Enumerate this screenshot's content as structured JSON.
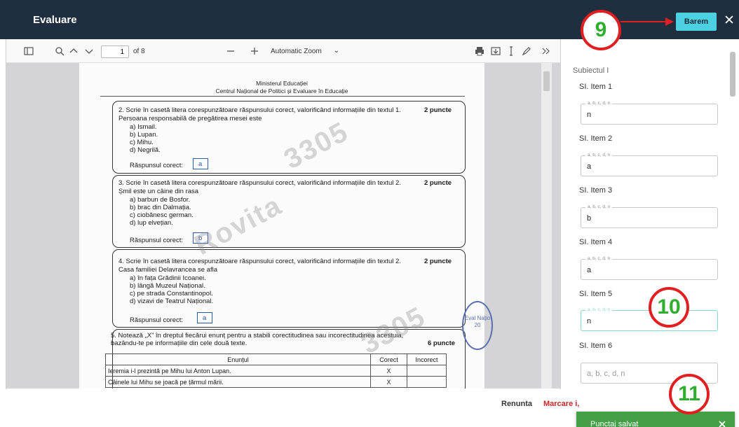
{
  "header": {
    "title": "Evaluare",
    "barem_label": "Barem"
  },
  "annotations": {
    "badge_9": "9",
    "badge_10": "10",
    "badge_11": "11"
  },
  "pdf_toolbar": {
    "page_current": "1",
    "page_total_label": "of 8",
    "zoom_label": "Automatic Zoom"
  },
  "document": {
    "header_line1": "Ministerul Educației",
    "header_line2": "Centrul Național de Politici și Evaluare în Educație",
    "q2": {
      "text": "2. Scrie în casetă litera corespunzătoare răspunsului corect, valorificând informațiile din textul 1.",
      "points": "2 puncte",
      "prompt": "Persoana responsabilă de pregătirea mesei este",
      "options": [
        "a) Ismail.",
        "b) Lupan.",
        "c) Mihu.",
        "d) Negrilă."
      ],
      "answer_label": "Răspunsul corect:",
      "answer": "a"
    },
    "q3": {
      "text": "3. Scrie în casetă litera corespunzătoare răspunsului corect, valorificând informațiile din textul 2.",
      "points": "2 puncte",
      "prompt": "Șmil este un câine din rasa",
      "options": [
        "a) barbun de Bosfor.",
        "b) brac din Dalmația.",
        "c) ciobănesc german.",
        "d) lup elvețian."
      ],
      "answer_label": "Răspunsul corect:",
      "answer": "b"
    },
    "q4": {
      "text": "4. Scrie în casetă litera corespunzătoare răspunsului corect, valorificând informațiile din textul 2.",
      "points": "2 puncte",
      "prompt": "Casa familiei Delavrancea se afla",
      "options": [
        "a) în fața Grădinii Icoanei.",
        "b) lângă Muzeul Național.",
        "c) pe strada Constantinopol.",
        "d) vizavi de Teatrul Național."
      ],
      "answer_label": "Răspunsul corect:",
      "answer": "a"
    },
    "q5": {
      "text": "5. Notează „X” în dreptul fiecărui enunț pentru a stabili corectitudinea sau incorectitudinea acestuia,",
      "text2": "bazându-te pe informațiile din cele două texte.",
      "points": "6 puncte",
      "table_headers": [
        "Enunțul",
        "Corect",
        "Incorect"
      ],
      "rows": [
        {
          "statement": "Ieremia i-l prezintă pe Mihu lui Anton Lupan.",
          "corect": "X",
          "incorect": ""
        },
        {
          "statement": "Câinele lui Mihu se joacă pe țărmul mării.",
          "corect": "X",
          "incorect": ""
        }
      ]
    },
    "watermarks": [
      "3305",
      "Rovita",
      "3305"
    ],
    "stamp_text": "Eval Națio 20"
  },
  "panel": {
    "section_title": "Subiectul I",
    "field_legend": "a, b, c, d, n",
    "items": [
      {
        "label": "SI. Item 1",
        "value": "n"
      },
      {
        "label": "SI. Item 2",
        "value": "a"
      },
      {
        "label": "SI. Item 3",
        "value": "b"
      },
      {
        "label": "SI. Item 4",
        "value": "a"
      },
      {
        "label": "SI. Item 5",
        "value": "n"
      },
      {
        "label": "SI. Item 6",
        "value": ""
      }
    ],
    "item6_placeholder": "a, b, c, d, n"
  },
  "footer": {
    "renunta": "Renunta",
    "marcare": "Marcare i,"
  },
  "toast": {
    "message": "Punctaj salvat"
  },
  "colors": {
    "header": "#1f2f3f",
    "barem": "#4dd0e1",
    "toast": "#43a047",
    "annotation_ring": "#e02020",
    "annotation_number": "#2fae2f"
  }
}
